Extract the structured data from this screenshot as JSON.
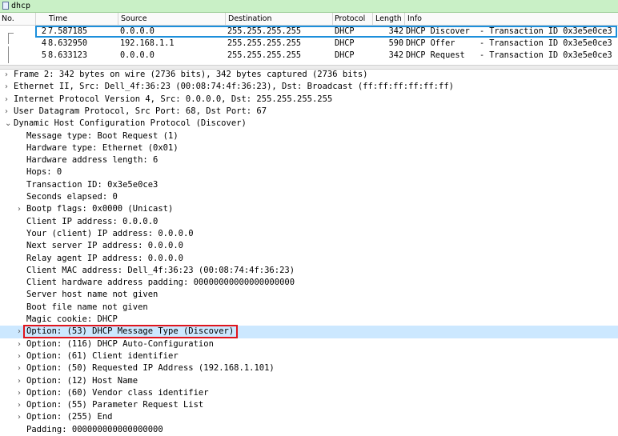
{
  "filter": {
    "value": "dhcp"
  },
  "columns": [
    "No.",
    "Time",
    "Source",
    "Destination",
    "Protocol",
    "Length",
    "Info"
  ],
  "packets": [
    {
      "no": "2",
      "time": "7.587185",
      "source": "0.0.0.0",
      "destination": "255.255.255.255",
      "protocol": "DHCP",
      "length": "342",
      "info": "DHCP Discover  - Transaction ID 0x3e5e0ce3",
      "selected": true
    },
    {
      "no": "4",
      "time": "8.632950",
      "source": "192.168.1.1",
      "destination": "255.255.255.255",
      "protocol": "DHCP",
      "length": "590",
      "info": "DHCP Offer     - Transaction ID 0x3e5e0ce3",
      "selected": false
    },
    {
      "no": "5",
      "time": "8.633123",
      "source": "0.0.0.0",
      "destination": "255.255.255.255",
      "protocol": "DHCP",
      "length": "342",
      "info": "DHCP Request   - Transaction ID 0x3e5e0ce3",
      "selected": false
    }
  ],
  "details": [
    {
      "text": "Frame 2: 342 bytes on wire (2736 bits), 342 bytes captured (2736 bits)",
      "level": 0,
      "expander": "collapsed"
    },
    {
      "text": "Ethernet II, Src: Dell_4f:36:23 (00:08:74:4f:36:23), Dst: Broadcast (ff:ff:ff:ff:ff:ff)",
      "level": 0,
      "expander": "collapsed"
    },
    {
      "text": "Internet Protocol Version 4, Src: 0.0.0.0, Dst: 255.255.255.255",
      "level": 0,
      "expander": "collapsed"
    },
    {
      "text": "User Datagram Protocol, Src Port: 68, Dst Port: 67",
      "level": 0,
      "expander": "collapsed"
    },
    {
      "text": "Dynamic Host Configuration Protocol (Discover)",
      "level": 0,
      "expander": "expanded"
    },
    {
      "text": "Message type: Boot Request (1)",
      "level": 1,
      "expander": "none"
    },
    {
      "text": "Hardware type: Ethernet (0x01)",
      "level": 1,
      "expander": "none"
    },
    {
      "text": "Hardware address length: 6",
      "level": 1,
      "expander": "none"
    },
    {
      "text": "Hops: 0",
      "level": 1,
      "expander": "none"
    },
    {
      "text": "Transaction ID: 0x3e5e0ce3",
      "level": 1,
      "expander": "none"
    },
    {
      "text": "Seconds elapsed: 0",
      "level": 1,
      "expander": "none"
    },
    {
      "text": "Bootp flags: 0x0000 (Unicast)",
      "level": 1,
      "expander": "collapsed"
    },
    {
      "text": "Client IP address: 0.0.0.0",
      "level": 1,
      "expander": "none"
    },
    {
      "text": "Your (client) IP address: 0.0.0.0",
      "level": 1,
      "expander": "none"
    },
    {
      "text": "Next server IP address: 0.0.0.0",
      "level": 1,
      "expander": "none"
    },
    {
      "text": "Relay agent IP address: 0.0.0.0",
      "level": 1,
      "expander": "none"
    },
    {
      "text": "Client MAC address: Dell_4f:36:23 (00:08:74:4f:36:23)",
      "level": 1,
      "expander": "none"
    },
    {
      "text": "Client hardware address padding: 00000000000000000000",
      "level": 1,
      "expander": "none"
    },
    {
      "text": "Server host name not given",
      "level": 1,
      "expander": "none"
    },
    {
      "text": "Boot file name not given",
      "level": 1,
      "expander": "none"
    },
    {
      "text": "Magic cookie: DHCP",
      "level": 1,
      "expander": "none"
    },
    {
      "text": "Option: (53) DHCP Message Type (Discover)",
      "level": 1,
      "expander": "collapsed",
      "highlighted": true
    },
    {
      "text": "Option: (116) DHCP Auto-Configuration",
      "level": 1,
      "expander": "collapsed"
    },
    {
      "text": "Option: (61) Client identifier",
      "level": 1,
      "expander": "collapsed"
    },
    {
      "text": "Option: (50) Requested IP Address (192.168.1.101)",
      "level": 1,
      "expander": "collapsed"
    },
    {
      "text": "Option: (12) Host Name",
      "level": 1,
      "expander": "collapsed"
    },
    {
      "text": "Option: (60) Vendor class identifier",
      "level": 1,
      "expander": "collapsed"
    },
    {
      "text": "Option: (55) Parameter Request List",
      "level": 1,
      "expander": "collapsed"
    },
    {
      "text": "Option: (255) End",
      "level": 1,
      "expander": "collapsed"
    },
    {
      "text": "Padding: 000000000000000000",
      "level": 1,
      "expander": "none"
    }
  ],
  "icons": {
    "collapsed": "›",
    "expanded": "⌄"
  },
  "colors": {
    "filter_bg": "#c9f0c6",
    "selected_border": "#1c8fdb",
    "highlight_bg": "#cce8ff",
    "annotation_red": "#e0151d"
  }
}
